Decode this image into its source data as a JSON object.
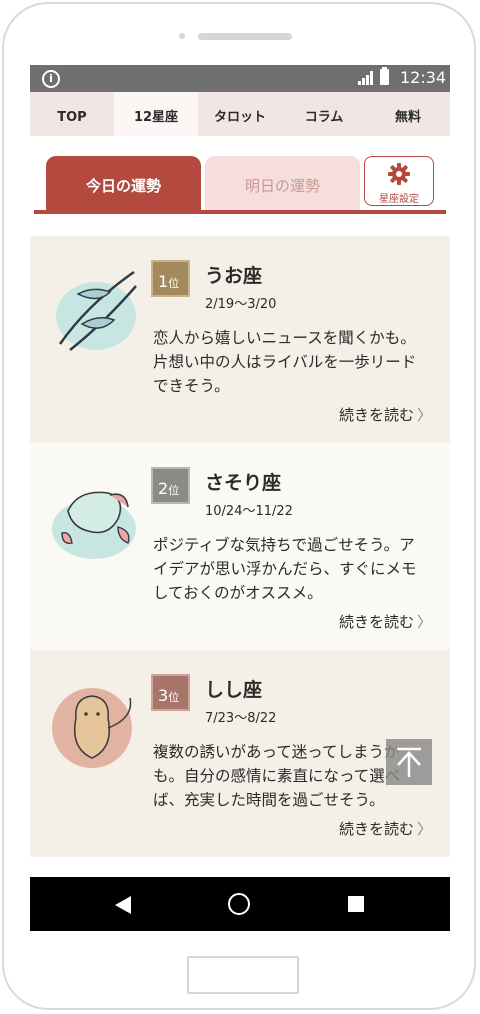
{
  "status_bar": {
    "time": "12:34",
    "info_icon": "info-icon",
    "signal_icon": "signal-icon",
    "battery_icon": "battery-icon"
  },
  "nav": {
    "items": [
      "TOP",
      "12星座",
      "タロット",
      "コラム",
      "無料"
    ],
    "active": "12星座"
  },
  "tabs": {
    "today": "今日の運勢",
    "tomorrow": "明日の運勢",
    "settings": "星座設定",
    "settings_icon": "gear-icon"
  },
  "ranking": [
    {
      "rank": "1",
      "rank_suffix": "位",
      "name": "うお座",
      "dates": "2/19〜3/20",
      "lines": [
        "恋人から嬉しいニュースを聞くかも。",
        "片想い中の人はライバルを一歩リード",
        "できそう。"
      ],
      "more": "続きを読む"
    },
    {
      "rank": "2",
      "rank_suffix": "位",
      "name": "さそり座",
      "dates": "10/24〜11/22",
      "lines": [
        "ポジティブな気持ちで過ごせそう。ア",
        "イデアが思い浮かんだら、すぐにメモ",
        "しておくのがオススメ。"
      ],
      "more": "続きを読む"
    },
    {
      "rank": "3",
      "rank_suffix": "位",
      "name": "しし座",
      "dates": "7/23〜8/22",
      "lines": [
        "複数の誘いがあって迷ってしまうか",
        "も。自分の感情に素直になって選べ",
        "ば、充実した時間を過ごせそう。"
      ],
      "more": "続きを読む"
    }
  ],
  "colors": {
    "accent": "#b3493f",
    "rank1": "#a38a5c",
    "rank2": "#8c8a86",
    "rank3": "#a8756a"
  },
  "icons": {
    "back_to_top": "arrow-up-icon",
    "chevron": "chevron-right-icon"
  }
}
